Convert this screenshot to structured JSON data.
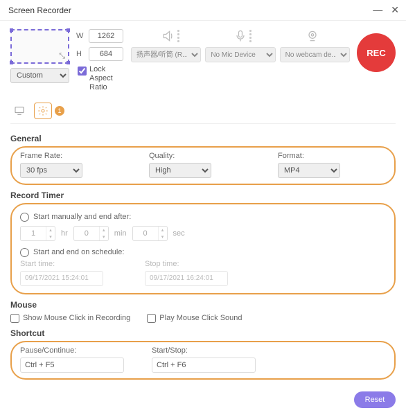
{
  "window": {
    "title": "Screen Recorder"
  },
  "region": {
    "width": "1262",
    "height": "684",
    "preset": "Custom",
    "lock_label": "Lock Aspect Ratio",
    "w_label": "W",
    "h_label": "H"
  },
  "devices": {
    "audio_out": "扬声器/听筒 (R...",
    "mic": "No Mic Device",
    "webcam": "No webcam de..."
  },
  "rec_label": "REC",
  "tabs": {
    "badge": "1"
  },
  "general": {
    "title": "General",
    "frame_rate_label": "Frame Rate:",
    "frame_rate": "30 fps",
    "quality_label": "Quality:",
    "quality": "High",
    "format_label": "Format:",
    "format": "MP4"
  },
  "timer": {
    "title": "Record Timer",
    "manual_label": "Start manually and end after:",
    "hr": "1",
    "hr_unit": "hr",
    "min": "0",
    "min_unit": "min",
    "sec": "0",
    "sec_unit": "sec",
    "schedule_label": "Start and end on schedule:",
    "start_label": "Start time:",
    "start_value": "09/17/2021 15:24:01",
    "stop_label": "Stop time:",
    "stop_value": "09/17/2021 16:24:01"
  },
  "mouse": {
    "title": "Mouse",
    "show_click": "Show Mouse Click in Recording",
    "play_sound": "Play Mouse Click Sound"
  },
  "shortcut": {
    "title": "Shortcut",
    "pause_label": "Pause/Continue:",
    "pause_value": "Ctrl + F5",
    "startstop_label": "Start/Stop:",
    "startstop_value": "Ctrl + F6"
  },
  "footer": {
    "reset": "Reset"
  }
}
